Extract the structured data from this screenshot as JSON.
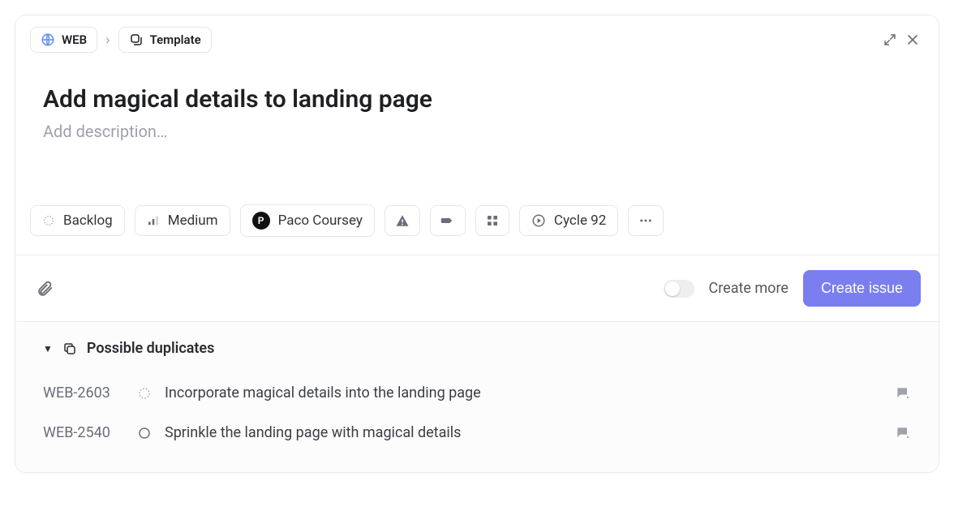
{
  "breadcrumb": {
    "project_label": "WEB",
    "template_label": "Template"
  },
  "issue": {
    "title": "Add magical details to landing page",
    "description_placeholder": "Add description…"
  },
  "properties": {
    "status_label": "Backlog",
    "priority_label": "Medium",
    "assignee_label": "Paco Coursey",
    "assignee_initial": "P",
    "cycle_label": "Cycle 92"
  },
  "footer": {
    "create_more_label": "Create more",
    "create_more_on": false,
    "submit_label": "Create issue"
  },
  "duplicates": {
    "heading": "Possible duplicates",
    "items": [
      {
        "id": "WEB-2603",
        "title": "Incorporate magical details into the landing page",
        "status": "backlog"
      },
      {
        "id": "WEB-2540",
        "title": "Sprinkle the landing page with magical details",
        "status": "todo"
      }
    ]
  }
}
